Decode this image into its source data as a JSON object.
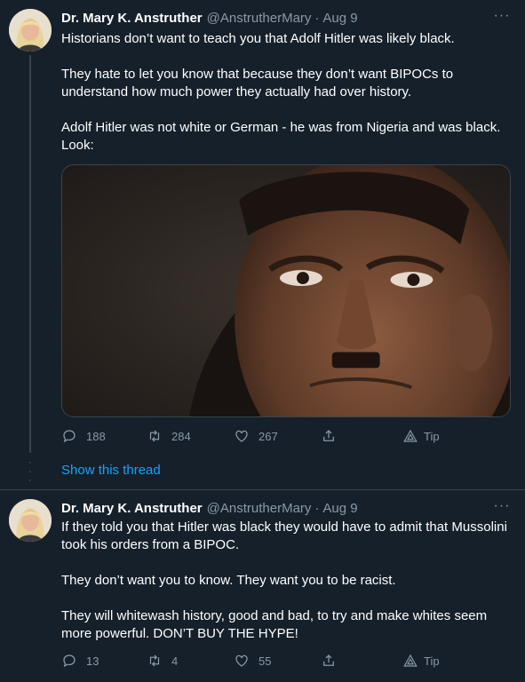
{
  "tweet1": {
    "name": "Dr. Mary K. Anstruther",
    "handle": "@AnstrutherMary",
    "dot": "·",
    "time": "Aug 9",
    "more": "···",
    "lines": [
      "Historians don’t want to teach you that Adolf Hitler was likely black.",
      "They hate to let you know that because they don’t want BIPOCs to understand how much power they actually had over history.",
      "Adolf Hitler was not white or German - he was from Nigeria and was black. Look:"
    ],
    "replies": "188",
    "retweets": "284",
    "likes": "267",
    "tip": "Tip"
  },
  "show_thread": "Show this thread",
  "tweet2": {
    "name": "Dr. Mary K. Anstruther",
    "handle": "@AnstrutherMary",
    "dot": "·",
    "time": "Aug 9",
    "more": "···",
    "lines": [
      "If they told you that Hitler was black they would have to admit that Mussolini took his orders from a BIPOC.",
      "They don’t want you to know. They want you to be racist.",
      "They will whitewash history, good and bad, to try and make whites seem more powerful. DON’T BUY THE HYPE!"
    ],
    "replies": "13",
    "retweets": "4",
    "likes": "55",
    "tip": "Tip"
  },
  "colors": {
    "background": "#15202b",
    "secondary_text": "#8899a6",
    "link": "#1da1f2",
    "divider": "#38444d"
  },
  "icons": [
    "reply-icon",
    "retweet-icon",
    "like-icon",
    "share-icon",
    "tip-icon",
    "more-icon"
  ]
}
